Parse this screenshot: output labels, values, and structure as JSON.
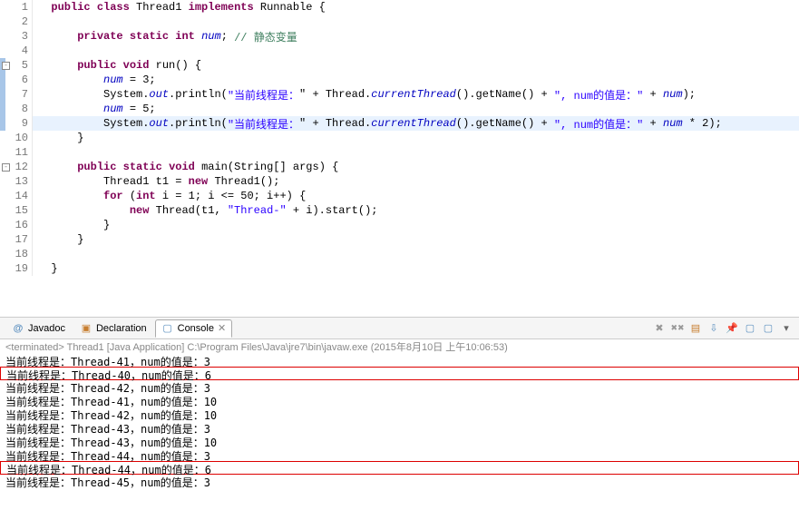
{
  "editor": {
    "lines": [
      {
        "n": 1,
        "hl": false,
        "fold": "",
        "tokens": [
          [
            "",
            "  "
          ],
          [
            "kw",
            "public"
          ],
          [
            "",
            " "
          ],
          [
            "kw",
            "class"
          ],
          [
            "",
            " Thread1 "
          ],
          [
            "kw",
            "implements"
          ],
          [
            "",
            " Runnable {"
          ]
        ]
      },
      {
        "n": 2,
        "hl": false,
        "fold": "",
        "tokens": [
          [
            "",
            ""
          ]
        ]
      },
      {
        "n": 3,
        "hl": false,
        "fold": "",
        "tokens": [
          [
            "",
            "      "
          ],
          [
            "kw",
            "private"
          ],
          [
            "",
            " "
          ],
          [
            "kw",
            "static"
          ],
          [
            "",
            " "
          ],
          [
            "kw",
            "int"
          ],
          [
            "",
            " "
          ],
          [
            "stat",
            "num"
          ],
          [
            "",
            ";"
          ],
          [
            "",
            " "
          ],
          [
            "com",
            "// 静态变量"
          ]
        ]
      },
      {
        "n": 4,
        "hl": false,
        "fold": "",
        "tokens": [
          [
            "",
            ""
          ]
        ]
      },
      {
        "n": 5,
        "hl": false,
        "fold": "-",
        "mark": true,
        "tokens": [
          [
            "",
            "      "
          ],
          [
            "kw",
            "public"
          ],
          [
            "",
            " "
          ],
          [
            "kw",
            "void"
          ],
          [
            "",
            " run() {"
          ]
        ]
      },
      {
        "n": 6,
        "hl": false,
        "fold": "",
        "mark": true,
        "tokens": [
          [
            "",
            "          "
          ],
          [
            "stat",
            "num"
          ],
          [
            "",
            " = 3;"
          ]
        ]
      },
      {
        "n": 7,
        "hl": false,
        "fold": "",
        "mark": true,
        "tokens": [
          [
            "",
            "          System."
          ],
          [
            "stat",
            "out"
          ],
          [
            "",
            ".println("
          ],
          [
            "str",
            "\"当前线程是："
          ],
          [
            "",
            "\" + Thread."
          ],
          [
            "stat",
            "currentThread"
          ],
          [
            "",
            "().getName() + "
          ],
          [
            "str",
            "\", num的值是：\""
          ],
          [
            "",
            " + "
          ],
          [
            "stat",
            "num"
          ],
          [
            "",
            ");"
          ]
        ]
      },
      {
        "n": 8,
        "hl": false,
        "fold": "",
        "mark": true,
        "tokens": [
          [
            "",
            "          "
          ],
          [
            "stat",
            "num"
          ],
          [
            "",
            " = 5;"
          ]
        ]
      },
      {
        "n": 9,
        "hl": true,
        "fold": "",
        "mark": true,
        "tokens": [
          [
            "",
            "          System."
          ],
          [
            "stat",
            "out"
          ],
          [
            "",
            ".println("
          ],
          [
            "str",
            "\"当前线程是："
          ],
          [
            "",
            "\" + Thread."
          ],
          [
            "stat",
            "currentThread"
          ],
          [
            "",
            "().getName() + "
          ],
          [
            "str",
            "\", num的值是：\""
          ],
          [
            "",
            " + "
          ],
          [
            "stat",
            "num"
          ],
          [
            "",
            " * 2);"
          ]
        ]
      },
      {
        "n": 10,
        "hl": false,
        "fold": "",
        "tokens": [
          [
            "",
            "      }"
          ]
        ]
      },
      {
        "n": 11,
        "hl": false,
        "fold": "",
        "tokens": [
          [
            "",
            ""
          ]
        ]
      },
      {
        "n": 12,
        "hl": false,
        "fold": "-",
        "tokens": [
          [
            "",
            "      "
          ],
          [
            "kw",
            "public"
          ],
          [
            "",
            " "
          ],
          [
            "kw",
            "static"
          ],
          [
            "",
            " "
          ],
          [
            "kw",
            "void"
          ],
          [
            "",
            " main(String[] args) {"
          ]
        ]
      },
      {
        "n": 13,
        "hl": false,
        "fold": "",
        "tokens": [
          [
            "",
            "          Thread1 t1 = "
          ],
          [
            "kw",
            "new"
          ],
          [
            "",
            " Thread1();"
          ]
        ]
      },
      {
        "n": 14,
        "hl": false,
        "fold": "",
        "tokens": [
          [
            "",
            "          "
          ],
          [
            "kw",
            "for"
          ],
          [
            "",
            " ("
          ],
          [
            "kw",
            "int"
          ],
          [
            "",
            " i = 1; i <= 50; i++) {"
          ]
        ]
      },
      {
        "n": 15,
        "hl": false,
        "fold": "",
        "tokens": [
          [
            "",
            "              "
          ],
          [
            "kw",
            "new"
          ],
          [
            "",
            " Thread(t1, "
          ],
          [
            "str",
            "\"Thread-\""
          ],
          [
            "",
            " + i).start();"
          ]
        ]
      },
      {
        "n": 16,
        "hl": false,
        "fold": "",
        "tokens": [
          [
            "",
            "          }"
          ]
        ]
      },
      {
        "n": 17,
        "hl": false,
        "fold": "",
        "tokens": [
          [
            "",
            "      }"
          ]
        ]
      },
      {
        "n": 18,
        "hl": false,
        "fold": "",
        "tokens": [
          [
            "",
            ""
          ]
        ]
      },
      {
        "n": 19,
        "hl": false,
        "fold": "",
        "tokens": [
          [
            "",
            "  }"
          ]
        ]
      }
    ]
  },
  "tabs": {
    "javadoc": "Javadoc",
    "declaration": "Declaration",
    "console": "Console"
  },
  "console": {
    "header": "<terminated> Thread1 [Java Application] C:\\Program Files\\Java\\jre7\\bin\\javaw.exe (2015年8月10日 上午10:06:53)",
    "lines": [
      {
        "text": "当前线程是：Thread-41，num的值是：3",
        "boxed": false
      },
      {
        "text": "当前线程是：Thread-40，num的值是：6",
        "boxed": true
      },
      {
        "text": "当前线程是：Thread-42，num的值是：3",
        "boxed": false
      },
      {
        "text": "当前线程是：Thread-41，num的值是：10",
        "boxed": false
      },
      {
        "text": "当前线程是：Thread-42，num的值是：10",
        "boxed": false
      },
      {
        "text": "当前线程是：Thread-43，num的值是：3",
        "boxed": false
      },
      {
        "text": "当前线程是：Thread-43，num的值是：10",
        "boxed": false
      },
      {
        "text": "当前线程是：Thread-44，num的值是：3",
        "boxed": false
      },
      {
        "text": "当前线程是：Thread-44，num的值是：6",
        "boxed": true
      },
      {
        "text": "当前线程是：Thread-45，num的值是：3",
        "boxed": false
      }
    ]
  },
  "icons": {
    "javadoc": "@",
    "declaration": "▣",
    "console": "▢",
    "close": "✕",
    "remove": "✖",
    "removeAll": "✖✖",
    "clear": "▤",
    "pin": "📌",
    "options": "▾"
  }
}
